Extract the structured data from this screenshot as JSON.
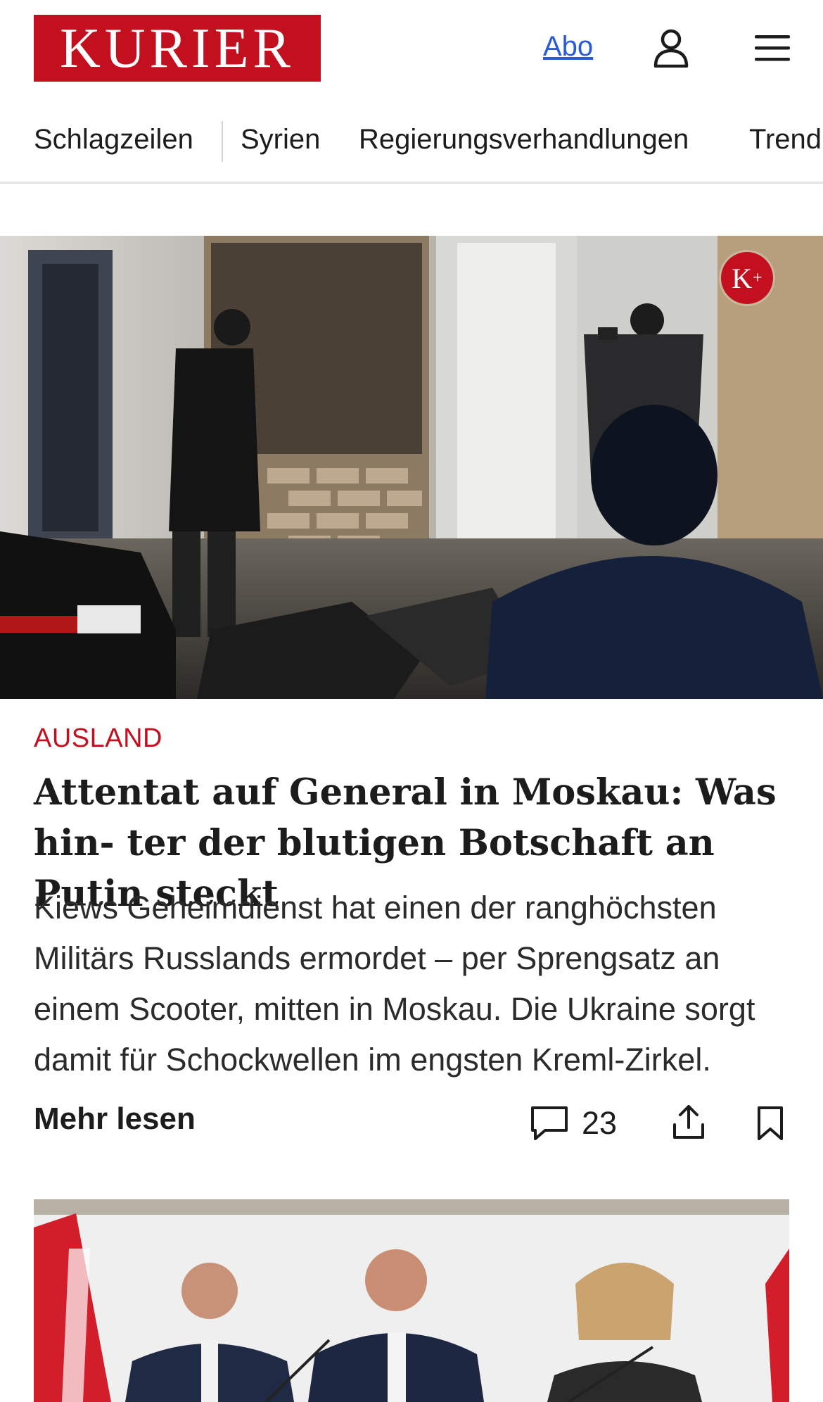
{
  "colors": {
    "brand_red": "#c3101f",
    "link_blue": "#2a5bd7",
    "text": "#1c1c1c"
  },
  "header": {
    "logo_text": "KURIER",
    "abo_label": "Abo",
    "user_icon": "user-icon",
    "menu_icon": "hamburger-menu-icon"
  },
  "nav": {
    "items": [
      "Schlagzeilen",
      "Syrien",
      "Regierungsverhandlungen",
      "Trend"
    ]
  },
  "article": {
    "badge": {
      "letter": "K",
      "sup": "+"
    },
    "category": "AUSLAND",
    "headline": "Attentat auf General in Moskau: Was hin- ter der blutigen Botschaft an Putin steckt",
    "teaser": "Kiews Geheimdienst hat einen der ranghöchsten Militärs Russlands ermordet – per Sprengsatz an einem Scooter, mitten in Moskau. Die Ukraine sorgt damit für Schockwellen im engsten Kreml-Zirkel.",
    "more_label": "Mehr lesen",
    "comment_count": "23"
  }
}
